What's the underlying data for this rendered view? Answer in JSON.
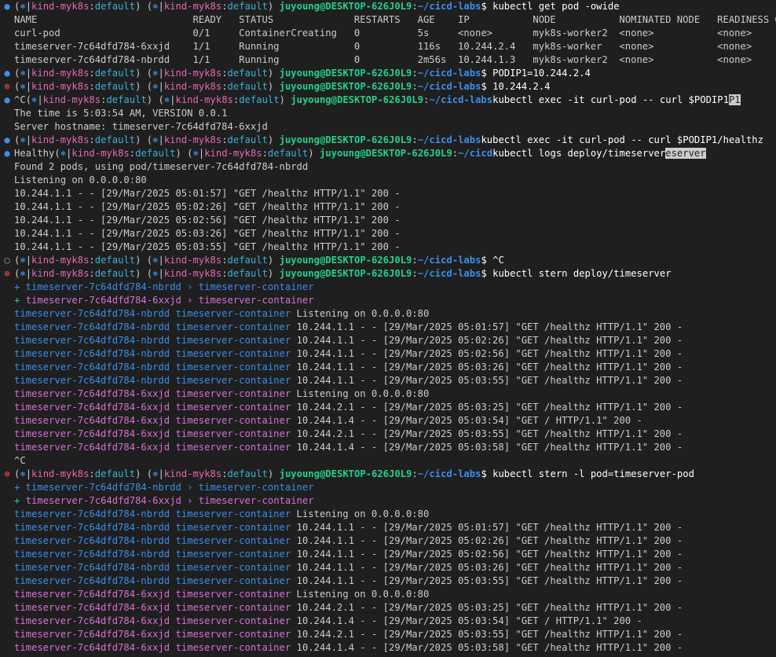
{
  "colors": {
    "background": "#1f1f1f",
    "default_text": "#cccccc",
    "context": "#e46ab0",
    "namespace": "#3bb0d8",
    "user_host": "#23d18b",
    "path": "#3b8eea",
    "pod_blue": "#3b8eea",
    "pod_magenta": "#d670d6",
    "success_marker": "#3b8eea",
    "error_marker": "#f14c4c"
  },
  "lines": [
    {
      "marker": "success",
      "segs": [
        [
          "def",
          "("
        ],
        [
          "icon",
          "⎈"
        ],
        [
          "def",
          "|"
        ],
        [
          "ctx",
          "kind-myk8s"
        ],
        [
          "def",
          ":"
        ],
        [
          "ns",
          "default"
        ],
        [
          "def",
          ") ("
        ],
        [
          "icon",
          "⎈"
        ],
        [
          "def",
          "|"
        ],
        [
          "ctx",
          "kind-myk8s"
        ],
        [
          "def",
          ":"
        ],
        [
          "ns",
          "default"
        ],
        [
          "def",
          ") "
        ],
        [
          "user",
          "juyoung@DESKTOP-626J0L9"
        ],
        [
          "def",
          ":"
        ],
        [
          "path",
          "~/cicd-labs"
        ],
        [
          "cmd",
          "$ kubectl get pod -owide"
        ]
      ]
    },
    {
      "segs": [
        [
          "def",
          "NAME                           READY   STATUS              RESTARTS   AGE    IP           NODE           NOMINATED NODE   READINESS GATES"
        ]
      ]
    },
    {
      "segs": [
        [
          "def",
          "curl-pod                       0/1     ContainerCreating   0          5s     <none>       myk8s-worker2  <none>           <none>"
        ]
      ]
    },
    {
      "segs": [
        [
          "def",
          "timeserver-7c64dfd784-6xxjd    1/1     Running             0          116s   10.244.2.4   myk8s-worker   <none>           <none>"
        ]
      ]
    },
    {
      "segs": [
        [
          "def",
          "timeserver-7c64dfd784-nbrdd    1/1     Running             0          2m56s  10.244.1.3   myk8s-worker2  <none>           <none>"
        ]
      ]
    },
    {
      "marker": "success",
      "segs": [
        [
          "def",
          "("
        ],
        [
          "icon",
          "⎈"
        ],
        [
          "def",
          "|"
        ],
        [
          "ctx",
          "kind-myk8s"
        ],
        [
          "def",
          ":"
        ],
        [
          "ns",
          "default"
        ],
        [
          "def",
          ") ("
        ],
        [
          "icon",
          "⎈"
        ],
        [
          "def",
          "|"
        ],
        [
          "ctx",
          "kind-myk8s"
        ],
        [
          "def",
          ":"
        ],
        [
          "ns",
          "default"
        ],
        [
          "def",
          ") "
        ],
        [
          "user",
          "juyoung@DESKTOP-626J0L9"
        ],
        [
          "def",
          ":"
        ],
        [
          "path",
          "~/cicd-labs"
        ],
        [
          "cmd",
          "$ PODIP1=10.244.2.4"
        ]
      ]
    },
    {
      "marker": "error",
      "segs": [
        [
          "def",
          "("
        ],
        [
          "icon",
          "⎈"
        ],
        [
          "def",
          "|"
        ],
        [
          "ctx",
          "kind-myk8s"
        ],
        [
          "def",
          ":"
        ],
        [
          "ns",
          "default"
        ],
        [
          "def",
          ") ("
        ],
        [
          "icon",
          "⎈"
        ],
        [
          "def",
          "|"
        ],
        [
          "ctx",
          "kind-myk8s"
        ],
        [
          "def",
          ":"
        ],
        [
          "ns",
          "default"
        ],
        [
          "def",
          ") "
        ],
        [
          "user",
          "juyoung@DESKTOP-626J0L9"
        ],
        [
          "def",
          ":"
        ],
        [
          "path",
          "~/cicd-labs"
        ],
        [
          "cmd",
          "$ 10.244.2.4"
        ]
      ]
    },
    {
      "marker": "success",
      "segs": [
        [
          "def",
          "^C("
        ],
        [
          "icon",
          "⎈"
        ],
        [
          "def",
          "|"
        ],
        [
          "ctx",
          "kind-myk8s"
        ],
        [
          "def",
          ":"
        ],
        [
          "ns",
          "default"
        ],
        [
          "def",
          ") ("
        ],
        [
          "icon",
          "⎈"
        ],
        [
          "def",
          "|"
        ],
        [
          "ctx",
          "kind-myk8s"
        ],
        [
          "def",
          ":"
        ],
        [
          "ns",
          "default"
        ],
        [
          "def",
          ") "
        ],
        [
          "user",
          "juyoung@DESKTOP-626J0L9"
        ],
        [
          "def",
          ":"
        ],
        [
          "path",
          "~/cicd-labs"
        ],
        [
          "cmd",
          "kubectl exec -it curl-pod -- curl $PODIP1"
        ],
        [
          "cursor",
          "P1"
        ]
      ]
    },
    {
      "segs": [
        [
          "def",
          "The time is 5:03:54 AM, VERSION 0.0.1"
        ]
      ]
    },
    {
      "segs": [
        [
          "def",
          "Server hostname: timeserver-7c64dfd784-6xxjd"
        ]
      ]
    },
    {
      "marker": "success",
      "segs": [
        [
          "def",
          "("
        ],
        [
          "icon",
          "⎈"
        ],
        [
          "def",
          "|"
        ],
        [
          "ctx",
          "kind-myk8s"
        ],
        [
          "def",
          ":"
        ],
        [
          "ns",
          "default"
        ],
        [
          "def",
          ") ("
        ],
        [
          "icon",
          "⎈"
        ],
        [
          "def",
          "|"
        ],
        [
          "ctx",
          "kind-myk8s"
        ],
        [
          "def",
          ":"
        ],
        [
          "ns",
          "default"
        ],
        [
          "def",
          ") "
        ],
        [
          "user",
          "juyoung@DESKTOP-626J0L9"
        ],
        [
          "def",
          ":"
        ],
        [
          "path",
          "~/cicd-labs"
        ],
        [
          "cmd",
          "kubectl exec -it curl-pod -- curl $PODIP1/healthz"
        ]
      ]
    },
    {
      "marker": "success",
      "segs": [
        [
          "def",
          "Healthy("
        ],
        [
          "icon",
          "⎈"
        ],
        [
          "def",
          "|"
        ],
        [
          "ctx",
          "kind-myk8s"
        ],
        [
          "def",
          ":"
        ],
        [
          "ns",
          "default"
        ],
        [
          "def",
          ") ("
        ],
        [
          "icon",
          "⎈"
        ],
        [
          "def",
          "|"
        ],
        [
          "ctx",
          "kind-myk8s"
        ],
        [
          "def",
          ":"
        ],
        [
          "ns",
          "default"
        ],
        [
          "def",
          ") "
        ],
        [
          "user",
          "juyoung@DESKTOP-626J0L9"
        ],
        [
          "def",
          ":"
        ],
        [
          "path",
          "~/cicd"
        ],
        [
          "cmd",
          "kubectl logs deploy/timeserver"
        ],
        [
          "cursor",
          "eserver"
        ]
      ]
    },
    {
      "segs": [
        [
          "def",
          "Found 2 pods, using pod/timeserver-7c64dfd784-nbrdd"
        ]
      ]
    },
    {
      "segs": [
        [
          "def",
          "Listening on 0.0.0.0:80"
        ]
      ]
    },
    {
      "segs": [
        [
          "def",
          "10.244.1.1 - - [29/Mar/2025 05:01:57] \"GET /healthz HTTP/1.1\" 200 -"
        ]
      ]
    },
    {
      "segs": [
        [
          "def",
          "10.244.1.1 - - [29/Mar/2025 05:02:26] \"GET /healthz HTTP/1.1\" 200 -"
        ]
      ]
    },
    {
      "segs": [
        [
          "def",
          "10.244.1.1 - - [29/Mar/2025 05:02:56] \"GET /healthz HTTP/1.1\" 200 -"
        ]
      ]
    },
    {
      "segs": [
        [
          "def",
          "10.244.1.1 - - [29/Mar/2025 05:03:26] \"GET /healthz HTTP/1.1\" 200 -"
        ]
      ]
    },
    {
      "segs": [
        [
          "def",
          "10.244.1.1 - - [29/Mar/2025 05:03:55] \"GET /healthz HTTP/1.1\" 200 -"
        ]
      ]
    },
    {
      "marker": "neutral",
      "segs": [
        [
          "def",
          "("
        ],
        [
          "icon",
          "⎈"
        ],
        [
          "def",
          "|"
        ],
        [
          "ctx",
          "kind-myk8s"
        ],
        [
          "def",
          ":"
        ],
        [
          "ns",
          "default"
        ],
        [
          "def",
          ") ("
        ],
        [
          "icon",
          "⎈"
        ],
        [
          "def",
          "|"
        ],
        [
          "ctx",
          "kind-myk8s"
        ],
        [
          "def",
          ":"
        ],
        [
          "ns",
          "default"
        ],
        [
          "def",
          ") "
        ],
        [
          "user",
          "juyoung@DESKTOP-626J0L9"
        ],
        [
          "def",
          ":"
        ],
        [
          "path",
          "~/cicd-labs"
        ],
        [
          "cmd",
          "$ ^C"
        ]
      ]
    },
    {
      "marker": "error",
      "segs": [
        [
          "def",
          "("
        ],
        [
          "icon",
          "⎈"
        ],
        [
          "def",
          "|"
        ],
        [
          "ctx",
          "kind-myk8s"
        ],
        [
          "def",
          ":"
        ],
        [
          "ns",
          "default"
        ],
        [
          "def",
          ") ("
        ],
        [
          "icon",
          "⎈"
        ],
        [
          "def",
          "|"
        ],
        [
          "ctx",
          "kind-myk8s"
        ],
        [
          "def",
          ":"
        ],
        [
          "ns",
          "default"
        ],
        [
          "def",
          ") "
        ],
        [
          "user",
          "juyoung@DESKTOP-626J0L9"
        ],
        [
          "def",
          ":"
        ],
        [
          "path",
          "~/cicd-labs"
        ],
        [
          "cmd",
          "$ kubectl stern deploy/timeserver"
        ]
      ]
    },
    {
      "segs": [
        [
          "blue",
          "+ timeserver-7c64dfd784-nbrdd › timeserver-container"
        ]
      ]
    },
    {
      "segs": [
        [
          "green",
          "+ "
        ],
        [
          "mag",
          "timeserver-7c64dfd784-6xxjd › timeserver-container"
        ]
      ]
    },
    {
      "segs": [
        [
          "blue",
          "timeserver-7c64dfd784-nbrdd timeserver-container"
        ],
        [
          "def",
          " Listening on 0.0.0.0:80"
        ]
      ]
    },
    {
      "segs": [
        [
          "blue",
          "timeserver-7c64dfd784-nbrdd timeserver-container"
        ],
        [
          "def",
          " 10.244.1.1 - - [29/Mar/2025 05:01:57] \"GET /healthz HTTP/1.1\" 200 -"
        ]
      ]
    },
    {
      "segs": [
        [
          "blue",
          "timeserver-7c64dfd784-nbrdd timeserver-container"
        ],
        [
          "def",
          " 10.244.1.1 - - [29/Mar/2025 05:02:26] \"GET /healthz HTTP/1.1\" 200 -"
        ]
      ]
    },
    {
      "segs": [
        [
          "blue",
          "timeserver-7c64dfd784-nbrdd timeserver-container"
        ],
        [
          "def",
          " 10.244.1.1 - - [29/Mar/2025 05:02:56] \"GET /healthz HTTP/1.1\" 200 -"
        ]
      ]
    },
    {
      "segs": [
        [
          "blue",
          "timeserver-7c64dfd784-nbrdd timeserver-container"
        ],
        [
          "def",
          " 10.244.1.1 - - [29/Mar/2025 05:03:26] \"GET /healthz HTTP/1.1\" 200 -"
        ]
      ]
    },
    {
      "segs": [
        [
          "blue",
          "timeserver-7c64dfd784-nbrdd timeserver-container"
        ],
        [
          "def",
          " 10.244.1.1 - - [29/Mar/2025 05:03:55] \"GET /healthz HTTP/1.1\" 200 -"
        ]
      ]
    },
    {
      "segs": [
        [
          "mag",
          "timeserver-7c64dfd784-6xxjd timeserver-container"
        ],
        [
          "def",
          " Listening on 0.0.0.0:80"
        ]
      ]
    },
    {
      "segs": [
        [
          "mag",
          "timeserver-7c64dfd784-6xxjd timeserver-container"
        ],
        [
          "def",
          " 10.244.2.1 - - [29/Mar/2025 05:03:25] \"GET /healthz HTTP/1.1\" 200 -"
        ]
      ]
    },
    {
      "segs": [
        [
          "mag",
          "timeserver-7c64dfd784-6xxjd timeserver-container"
        ],
        [
          "def",
          " 10.244.1.4 - - [29/Mar/2025 05:03:54] \"GET / HTTP/1.1\" 200 -"
        ]
      ]
    },
    {
      "segs": [
        [
          "mag",
          "timeserver-7c64dfd784-6xxjd timeserver-container"
        ],
        [
          "def",
          " 10.244.2.1 - - [29/Mar/2025 05:03:55] \"GET /healthz HTTP/1.1\" 200 -"
        ]
      ]
    },
    {
      "segs": [
        [
          "mag",
          "timeserver-7c64dfd784-6xxjd timeserver-container"
        ],
        [
          "def",
          " 10.244.1.4 - - [29/Mar/2025 05:03:58] \"GET /healthz HTTP/1.1\" 200 -"
        ]
      ]
    },
    {
      "segs": [
        [
          "def",
          "^C"
        ]
      ]
    },
    {
      "marker": "error",
      "segs": [
        [
          "def",
          "("
        ],
        [
          "icon",
          "⎈"
        ],
        [
          "def",
          "|"
        ],
        [
          "ctx",
          "kind-myk8s"
        ],
        [
          "def",
          ":"
        ],
        [
          "ns",
          "default"
        ],
        [
          "def",
          ") ("
        ],
        [
          "icon",
          "⎈"
        ],
        [
          "def",
          "|"
        ],
        [
          "ctx",
          "kind-myk8s"
        ],
        [
          "def",
          ":"
        ],
        [
          "ns",
          "default"
        ],
        [
          "def",
          ") "
        ],
        [
          "user",
          "juyoung@DESKTOP-626J0L9"
        ],
        [
          "def",
          ":"
        ],
        [
          "path",
          "~/cicd-labs"
        ],
        [
          "cmd",
          "$ kubectl stern -l pod=timeserver-pod"
        ]
      ]
    },
    {
      "segs": [
        [
          "blue",
          "+ timeserver-7c64dfd784-nbrdd › timeserver-container"
        ]
      ]
    },
    {
      "segs": [
        [
          "green",
          "+ "
        ],
        [
          "mag",
          "timeserver-7c64dfd784-6xxjd › timeserver-container"
        ]
      ]
    },
    {
      "segs": [
        [
          "blue",
          "timeserver-7c64dfd784-nbrdd timeserver-container"
        ],
        [
          "def",
          " Listening on 0.0.0.0:80"
        ]
      ]
    },
    {
      "segs": [
        [
          "blue",
          "timeserver-7c64dfd784-nbrdd timeserver-container"
        ],
        [
          "def",
          " 10.244.1.1 - - [29/Mar/2025 05:01:57] \"GET /healthz HTTP/1.1\" 200 -"
        ]
      ]
    },
    {
      "segs": [
        [
          "blue",
          "timeserver-7c64dfd784-nbrdd timeserver-container"
        ],
        [
          "def",
          " 10.244.1.1 - - [29/Mar/2025 05:02:26] \"GET /healthz HTTP/1.1\" 200 -"
        ]
      ]
    },
    {
      "segs": [
        [
          "blue",
          "timeserver-7c64dfd784-nbrdd timeserver-container"
        ],
        [
          "def",
          " 10.244.1.1 - - [29/Mar/2025 05:02:56] \"GET /healthz HTTP/1.1\" 200 -"
        ]
      ]
    },
    {
      "segs": [
        [
          "blue",
          "timeserver-7c64dfd784-nbrdd timeserver-container"
        ],
        [
          "def",
          " 10.244.1.1 - - [29/Mar/2025 05:03:26] \"GET /healthz HTTP/1.1\" 200 -"
        ]
      ]
    },
    {
      "segs": [
        [
          "blue",
          "timeserver-7c64dfd784-nbrdd timeserver-container"
        ],
        [
          "def",
          " 10.244.1.1 - - [29/Mar/2025 05:03:55] \"GET /healthz HTTP/1.1\" 200 -"
        ]
      ]
    },
    {
      "segs": [
        [
          "mag",
          "timeserver-7c64dfd784-6xxjd timeserver-container"
        ],
        [
          "def",
          " Listening on 0.0.0.0:80"
        ]
      ]
    },
    {
      "segs": [
        [
          "mag",
          "timeserver-7c64dfd784-6xxjd timeserver-container"
        ],
        [
          "def",
          " 10.244.2.1 - - [29/Mar/2025 05:03:25] \"GET /healthz HTTP/1.1\" 200 -"
        ]
      ]
    },
    {
      "segs": [
        [
          "mag",
          "timeserver-7c64dfd784-6xxjd timeserver-container"
        ],
        [
          "def",
          " 10.244.1.4 - - [29/Mar/2025 05:03:54] \"GET / HTTP/1.1\" 200 -"
        ]
      ]
    },
    {
      "segs": [
        [
          "mag",
          "timeserver-7c64dfd784-6xxjd timeserver-container"
        ],
        [
          "def",
          " 10.244.2.1 - - [29/Mar/2025 05:03:55] \"GET /healthz HTTP/1.1\" 200 -"
        ]
      ]
    },
    {
      "segs": [
        [
          "mag",
          "timeserver-7c64dfd784-6xxjd timeserver-container"
        ],
        [
          "def",
          " 10.244.1.4 - - [29/Mar/2025 05:03:58] \"GET /healthz HTTP/1.1\" 200 -"
        ]
      ]
    }
  ]
}
